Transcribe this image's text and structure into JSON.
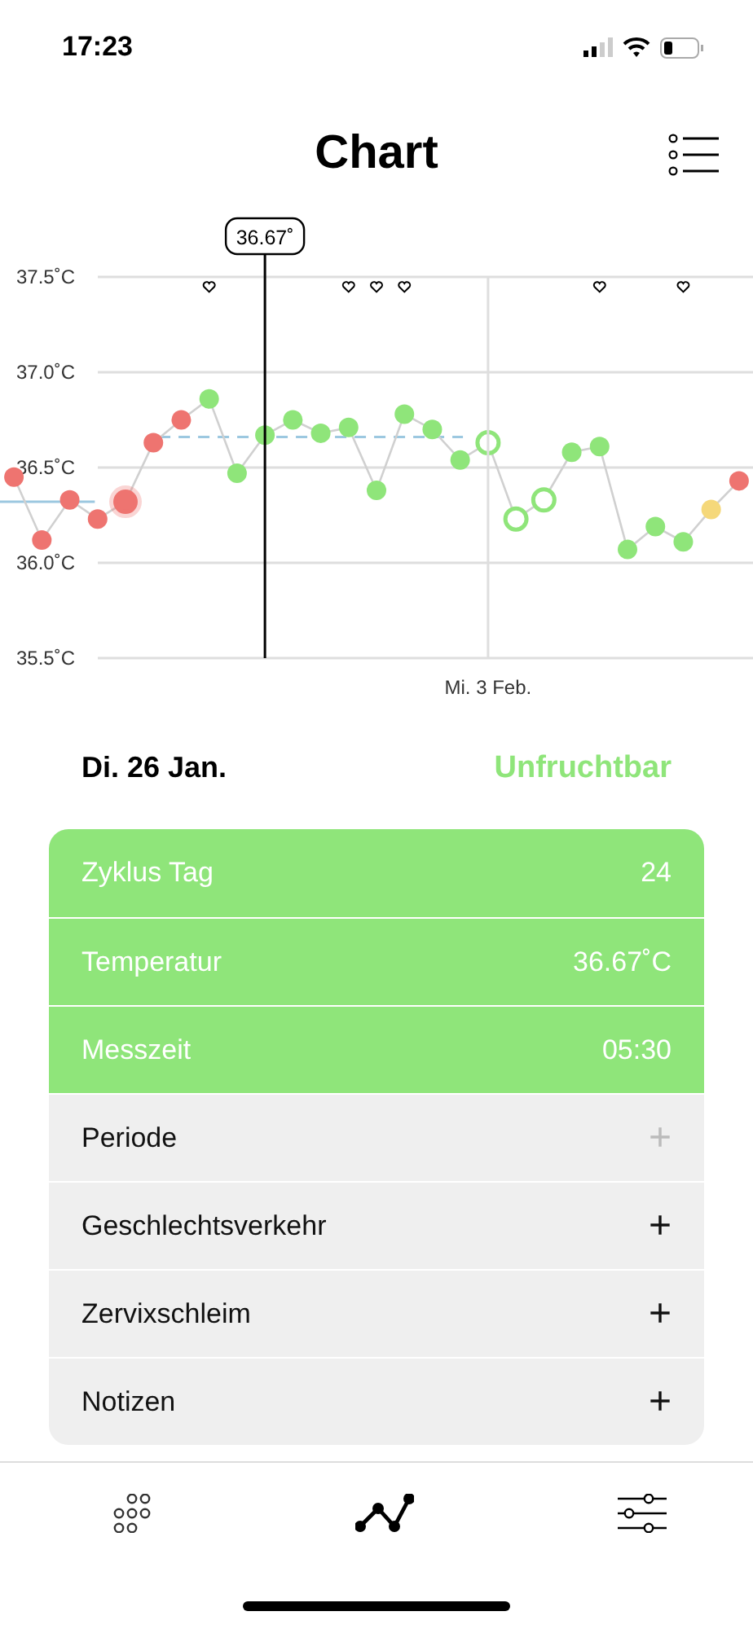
{
  "status_bar": {
    "time": "17:23"
  },
  "header": {
    "title": "Chart"
  },
  "chart": {
    "cursor_label": "36.67˚",
    "chart_data": {
      "type": "line",
      "grid": true,
      "categories": [
        null,
        null,
        null,
        null,
        null,
        null,
        null,
        null,
        null,
        null,
        null,
        null,
        null,
        null,
        null,
        null,
        null,
        null,
        null,
        null,
        null,
        null,
        null,
        null,
        null,
        null,
        null
      ],
      "ylim": [
        35.5,
        37.5
      ],
      "yticks": [
        {
          "value": 37.5,
          "label": "37.5˚C"
        },
        {
          "value": 37.0,
          "label": "37.0˚C"
        },
        {
          "value": 36.5,
          "label": "36.5˚C"
        },
        {
          "value": 36.0,
          "label": "36.0˚C"
        },
        {
          "value": 35.5,
          "label": "35.5˚C"
        }
      ],
      "series": [
        {
          "color": "#d0d0d0",
          "marker": "o",
          "values": [
            36.45,
            36.12,
            36.33,
            36.23,
            36.32,
            36.63,
            36.75,
            36.86,
            36.47,
            36.67,
            36.75,
            36.68,
            36.71,
            36.38,
            36.78,
            36.7,
            36.54,
            36.63,
            36.23,
            36.33,
            36.58,
            36.61,
            36.07,
            36.19,
            36.11,
            36.28,
            36.43
          ]
        }
      ],
      "ref_lines": [
        {
          "axis": "y",
          "value": 36.32
        },
        {
          "axis": "y",
          "value": 36.66
        }
      ]
    },
    "date_label": "Mi. 3 Feb.",
    "days": [
      {
        "color": "#ee7470",
        "hollow": false,
        "halo": false,
        "heart": false,
        "selected": false,
        "marked": false
      },
      {
        "color": "#ee7470",
        "hollow": false,
        "halo": false,
        "heart": false,
        "selected": false,
        "marked": false
      },
      {
        "color": "#ee7470",
        "hollow": false,
        "halo": false,
        "heart": false,
        "selected": false,
        "marked": false
      },
      {
        "color": "#ee7470",
        "hollow": false,
        "halo": false,
        "heart": false,
        "selected": false,
        "marked": false
      },
      {
        "color": "#ee7470",
        "hollow": false,
        "halo": true,
        "heart": false,
        "selected": false,
        "marked": false
      },
      {
        "color": "#ee7470",
        "hollow": false,
        "halo": false,
        "heart": false,
        "selected": false,
        "marked": false
      },
      {
        "color": "#ee7470",
        "hollow": false,
        "halo": false,
        "heart": false,
        "selected": false,
        "marked": false
      },
      {
        "color": "#8fe57a",
        "hollow": false,
        "halo": false,
        "heart": true,
        "selected": false,
        "marked": false
      },
      {
        "color": "#8fe57a",
        "hollow": false,
        "halo": false,
        "heart": false,
        "selected": false,
        "marked": false
      },
      {
        "color": "#8fe57a",
        "hollow": false,
        "halo": false,
        "heart": false,
        "selected": true,
        "marked": false
      },
      {
        "color": "#8fe57a",
        "hollow": false,
        "halo": false,
        "heart": false,
        "selected": false,
        "marked": false
      },
      {
        "color": "#8fe57a",
        "hollow": false,
        "halo": false,
        "heart": false,
        "selected": false,
        "marked": false
      },
      {
        "color": "#8fe57a",
        "hollow": false,
        "halo": false,
        "heart": true,
        "selected": false,
        "marked": false
      },
      {
        "color": "#8fe57a",
        "hollow": false,
        "halo": false,
        "heart": true,
        "selected": false,
        "marked": false
      },
      {
        "color": "#8fe57a",
        "hollow": false,
        "halo": false,
        "heart": true,
        "selected": false,
        "marked": false
      },
      {
        "color": "#8fe57a",
        "hollow": false,
        "halo": false,
        "heart": false,
        "selected": false,
        "marked": false
      },
      {
        "color": "#8fe57a",
        "hollow": false,
        "halo": false,
        "heart": false,
        "selected": false,
        "marked": false
      },
      {
        "color": "#8fe57a",
        "hollow": true,
        "halo": false,
        "heart": false,
        "selected": false,
        "marked": true
      },
      {
        "color": "#8fe57a",
        "hollow": true,
        "halo": false,
        "heart": false,
        "selected": false,
        "marked": false
      },
      {
        "color": "#8fe57a",
        "hollow": true,
        "halo": false,
        "heart": false,
        "selected": false,
        "marked": false
      },
      {
        "color": "#8fe57a",
        "hollow": false,
        "halo": false,
        "heart": false,
        "selected": false,
        "marked": false
      },
      {
        "color": "#8fe57a",
        "hollow": false,
        "halo": false,
        "heart": true,
        "selected": false,
        "marked": false
      },
      {
        "color": "#8fe57a",
        "hollow": false,
        "halo": false,
        "heart": false,
        "selected": false,
        "marked": false
      },
      {
        "color": "#8fe57a",
        "hollow": false,
        "halo": false,
        "heart": false,
        "selected": false,
        "marked": false
      },
      {
        "color": "#8fe57a",
        "hollow": false,
        "halo": false,
        "heart": true,
        "selected": false,
        "marked": false
      },
      {
        "color": "#f5d87a",
        "hollow": false,
        "halo": false,
        "heart": false,
        "selected": false,
        "marked": false
      },
      {
        "color": "#ee7470",
        "hollow": false,
        "halo": false,
        "heart": false,
        "selected": false,
        "marked": false
      }
    ]
  },
  "day": {
    "date": "Di. 26 Jan.",
    "status": "Unfruchtbar"
  },
  "rows": [
    {
      "kind": "info",
      "label": "Zyklus Tag",
      "value": "24"
    },
    {
      "kind": "info",
      "label": "Temperatur",
      "value": "36.67˚C"
    },
    {
      "kind": "info",
      "label": "Messzeit",
      "value": "05:30"
    },
    {
      "kind": "entry",
      "label": "Periode",
      "add": "+",
      "disabled": true
    },
    {
      "kind": "entry",
      "label": "Geschlechtsverkehr",
      "add": "+",
      "disabled": false
    },
    {
      "kind": "entry",
      "label": "Zervixschleim",
      "add": "+",
      "disabled": false
    },
    {
      "kind": "entry",
      "label": "Notizen",
      "add": "+",
      "disabled": false
    }
  ],
  "tabs": [
    {
      "selected": false
    },
    {
      "selected": true
    },
    {
      "selected": false
    }
  ]
}
